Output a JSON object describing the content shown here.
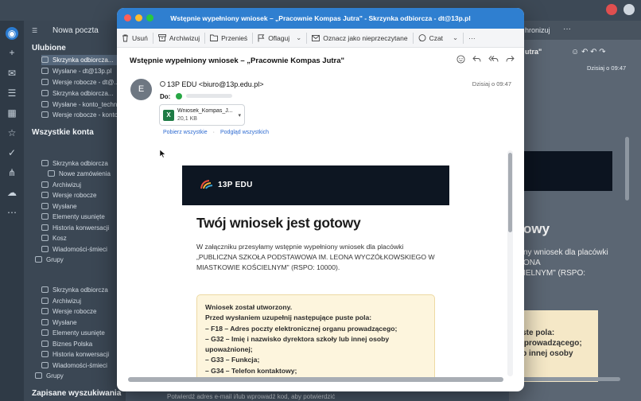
{
  "background": {
    "new_mail": "Nowa poczta",
    "toolbar_right": "hronizuj",
    "favorites_title": "Ulubione",
    "favorites": [
      "Skrzynka odbiorcza...",
      "Wysłane - dt@13p.pl",
      "Wersje robocze - dt@...",
      "Skrzynka odbiorcza...",
      "Wysłane - konto_techni...",
      "Wersje robocze - konto_..."
    ],
    "all_accounts": "Wszystkie konta",
    "account1_folders": [
      "Skrzynka odbiorcza",
      "Nowe zamówienia",
      "Archiwizuj",
      "Wersje robocze",
      "Wysłane",
      "Elementy usunięte",
      "Historia konwersacji",
      "Kosz",
      "Wiadomości-śmieci",
      "Grupy"
    ],
    "account2_folders": [
      "Skrzynka odbiorcza",
      "Archiwizuj",
      "Wersje robocze",
      "Wysłane",
      "Elementy usunięte",
      "Biznes Polska",
      "Historia konwersacji",
      "Wiadomości-śmieci",
      "Grupy"
    ],
    "saved_searches": "Zapisane wyszukiwania",
    "reading_pane_subject_tail": "utra\"",
    "reading_pane_time": "Dzisiaj o 09:47",
    "reading_pane_heading": "owy",
    "reading_pane_text": "ny wniosek dla placówki\nONA\nIELNYM\" (RSPO:",
    "reading_pane_notice": "uste pola:\nu prowadzącego;\nub innej osoby",
    "bottom_hint": "Potwierdź adres e-mail i/lub wprowadź kod, aby potwierdzić"
  },
  "window": {
    "title": "Wstępnie wypełniony wniosek – „Pracownie Kompas Jutra\" - Skrzynka odbiorcza - dt@13p.pl",
    "accent": "#2f7fd0"
  },
  "toolbar": {
    "delete": "Usuń",
    "archive": "Archiwizuj",
    "move": "Przenieś",
    "flag": "Oflaguj",
    "mark_unread": "Oznacz jako nieprzeczytane",
    "chat": "Czat",
    "more": "···"
  },
  "message": {
    "subject": "Wstępnie wypełniony wniosek – „Pracownie Kompas Jutra\"",
    "avatar_letter": "E",
    "from": "13P EDU <biuro@13p.edu.pl>",
    "to_label": "Do:",
    "date": "Dzisiaj o 09:47",
    "attachment": {
      "name": "Wniosek_Kompas_J...",
      "size": "20,1 KB"
    },
    "download_all": "Pobierz wszystkie",
    "preview_all": "Podgląd wszystkich"
  },
  "email_body": {
    "brand": "13P EDU",
    "heading": "Twój wniosek jest gotowy",
    "intro": "W załączniku przesyłamy wstępnie wypełniony wniosek dla placówki „PUBLICZNA SZKOŁA PODSTAWOWA IM. LEONA WYCZÓŁKOWSKIEGO W MIASTKOWIE KOŚCIELNYM\" (RSPO: 10000).",
    "notice_lines": [
      "Wniosek został utworzony.",
      "Przed wysłaniem uzupełnij następujące puste pola:",
      "– F18 – Adres poczty elektronicznej organu prowadzącego;",
      "– G32 – Imię i nazwisko dyrektora szkoły lub innej osoby",
      "upoważnionej;",
      "– G33 – Funkcja;",
      "– G34 – Telefon kontaktowy;"
    ]
  }
}
